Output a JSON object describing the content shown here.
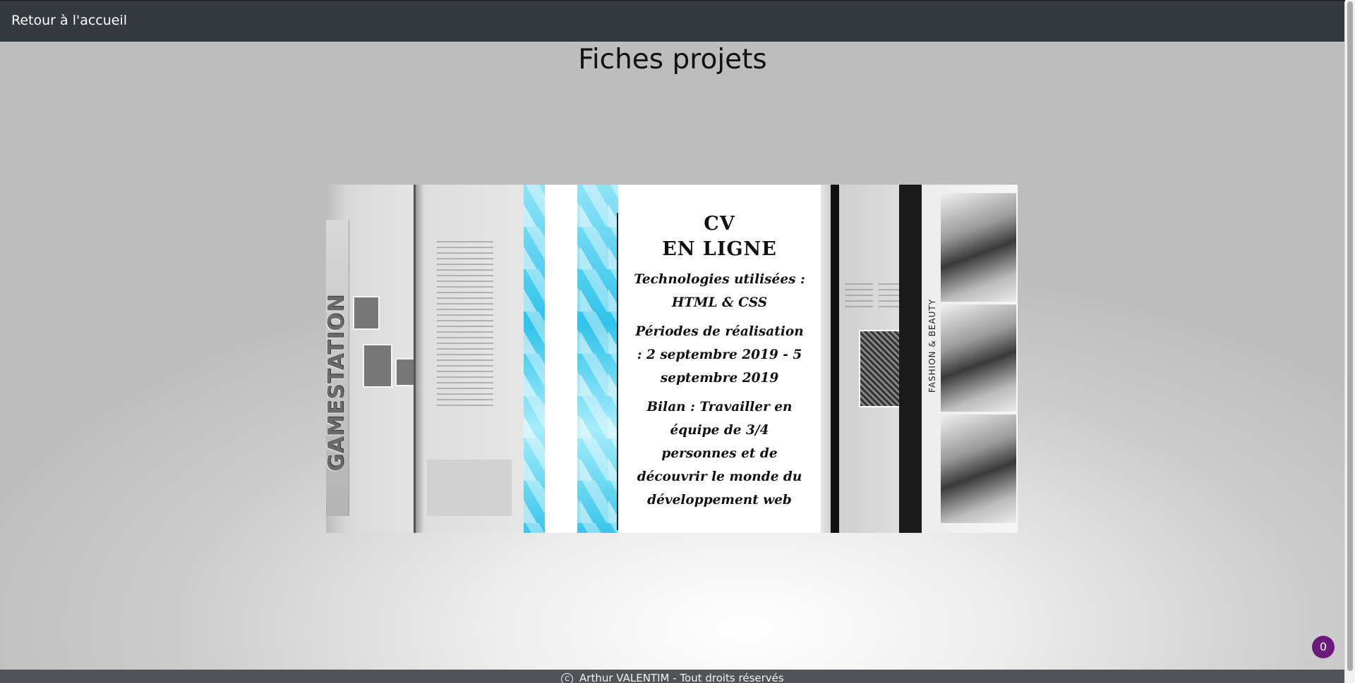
{
  "nav": {
    "back_label": "Retour à l'accueil"
  },
  "page": {
    "title": "Fiches projets"
  },
  "carousel": {
    "left_slice_text": "GAMESTATION",
    "right_slice_text": "FASHION & BEAUTY",
    "active_card": {
      "title_line1": "CV",
      "title_line2": "EN LIGNE",
      "technologies": "Technologies utilisées : HTML & CSS",
      "period": "Périodes de réalisation : 2 septembre 2019 - 5 septembre 2019",
      "summary": "Bilan : Travailler en équipe de 3/4 personnes et de découvrir le monde du développement web"
    }
  },
  "footer": {
    "copyright_symbol": "C",
    "text": "Arthur VALENTIM - Tout droits réservés"
  },
  "badge": {
    "count": "0",
    "color": "#6a1b7a"
  },
  "colors": {
    "topbar": "#343a40",
    "footer": "#505458",
    "accent_cyan": "#2fc3ea"
  }
}
